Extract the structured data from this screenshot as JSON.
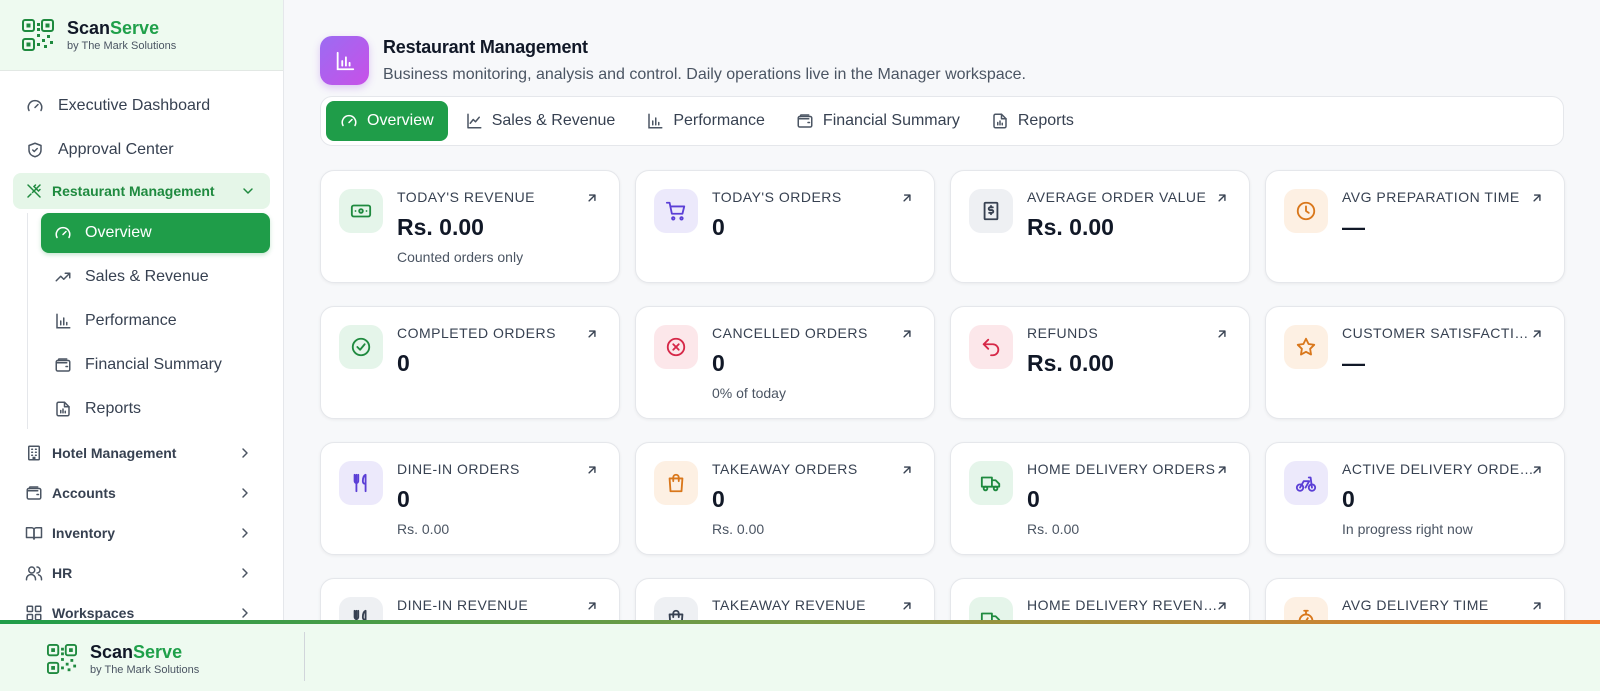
{
  "brand": {
    "name_part1": "Scan",
    "name_part2": "Serve",
    "subtitle": "by The Mark Solutions"
  },
  "sidebar": {
    "top_items": [
      {
        "label": "Executive Dashboard",
        "icon": "gauge-icon"
      },
      {
        "label": "Approval Center",
        "icon": "shield-check-icon"
      }
    ],
    "group": {
      "label": "Restaurant Management",
      "icon": "utensils-crossed-icon",
      "expanded": true
    },
    "sub_items": [
      {
        "label": "Overview",
        "icon": "gauge-icon",
        "active": true
      },
      {
        "label": "Sales & Revenue",
        "icon": "trending-up-icon"
      },
      {
        "label": "Performance",
        "icon": "bar-chart-icon"
      },
      {
        "label": "Financial Summary",
        "icon": "wallet-icon"
      },
      {
        "label": "Reports",
        "icon": "file-chart-icon"
      }
    ],
    "sections": [
      {
        "label": "Hotel Management",
        "icon": "building-icon"
      },
      {
        "label": "Accounts",
        "icon": "wallet-icon"
      },
      {
        "label": "Inventory",
        "icon": "book-icon"
      },
      {
        "label": "HR",
        "icon": "users-icon"
      },
      {
        "label": "Workspaces",
        "icon": "grid-icon"
      }
    ]
  },
  "header": {
    "title": "Restaurant Management",
    "subtitle": "Business monitoring, analysis and control. Daily operations live in the Manager workspace.",
    "icon": "bar-chart-icon"
  },
  "tabs": [
    {
      "label": "Overview",
      "icon": "gauge-icon",
      "active": true
    },
    {
      "label": "Sales & Revenue",
      "icon": "line-chart-icon"
    },
    {
      "label": "Performance",
      "icon": "bar-chart-icon"
    },
    {
      "label": "Financial Summary",
      "icon": "wallet-icon"
    },
    {
      "label": "Reports",
      "icon": "file-chart-icon"
    }
  ],
  "cards": [
    {
      "label": "TODAY'S REVENUE",
      "value": "Rs. 0.00",
      "note": "Counted orders only",
      "icon": "banknote-icon",
      "color": "#1f8a3f"
    },
    {
      "label": "TODAY'S ORDERS",
      "value": "0",
      "note": "",
      "icon": "cart-icon",
      "color": "#5b3fd6"
    },
    {
      "label": "AVERAGE ORDER VALUE",
      "value": "Rs. 0.00",
      "note": "",
      "icon": "receipt-dollar-icon",
      "color": "#374151"
    },
    {
      "label": "AVG PREPARATION TIME",
      "value": "—",
      "note": "",
      "icon": "clock-icon",
      "color": "#d9771b"
    },
    {
      "label": "COMPLETED ORDERS",
      "value": "0",
      "note": "",
      "icon": "check-circle-icon",
      "color": "#1f8a3f"
    },
    {
      "label": "CANCELLED ORDERS",
      "value": "0",
      "note": "0% of today",
      "icon": "x-circle-icon",
      "color": "#d62848"
    },
    {
      "label": "REFUNDS",
      "value": "Rs. 0.00",
      "note": "",
      "icon": "undo-icon",
      "color": "#d62848"
    },
    {
      "label": "CUSTOMER SATISFACTION",
      "value": "—",
      "note": "",
      "icon": "star-icon",
      "color": "#d9771b"
    },
    {
      "label": "DINE-IN ORDERS",
      "value": "0",
      "note": "Rs. 0.00",
      "icon": "utensils-icon",
      "color": "#5b3fd6"
    },
    {
      "label": "TAKEAWAY ORDERS",
      "value": "0",
      "note": "Rs. 0.00",
      "icon": "shopping-bag-icon",
      "color": "#d9771b"
    },
    {
      "label": "HOME DELIVERY ORDERS",
      "value": "0",
      "note": "Rs. 0.00",
      "icon": "truck-icon",
      "color": "#1f8a3f"
    },
    {
      "label": "ACTIVE DELIVERY ORDERS",
      "value": "0",
      "note": "In progress right now",
      "icon": "bike-icon",
      "color": "#5b3fd6"
    },
    {
      "label": "DINE-IN REVENUE",
      "value": "",
      "note": "",
      "icon": "utensils-icon",
      "color": "#374151"
    },
    {
      "label": "TAKEAWAY REVENUE",
      "value": "",
      "note": "",
      "icon": "shopping-bag-icon",
      "color": "#374151"
    },
    {
      "label": "HOME DELIVERY REVENUE",
      "value": "",
      "note": "",
      "icon": "truck-icon",
      "color": "#1f8a3f"
    },
    {
      "label": "AVG DELIVERY TIME",
      "value": "",
      "note": "",
      "icon": "timer-icon",
      "color": "#d9771b"
    }
  ],
  "footer": {
    "name_part1": "Scan",
    "name_part2": "Serve",
    "subtitle": "by The Mark Solutions"
  }
}
